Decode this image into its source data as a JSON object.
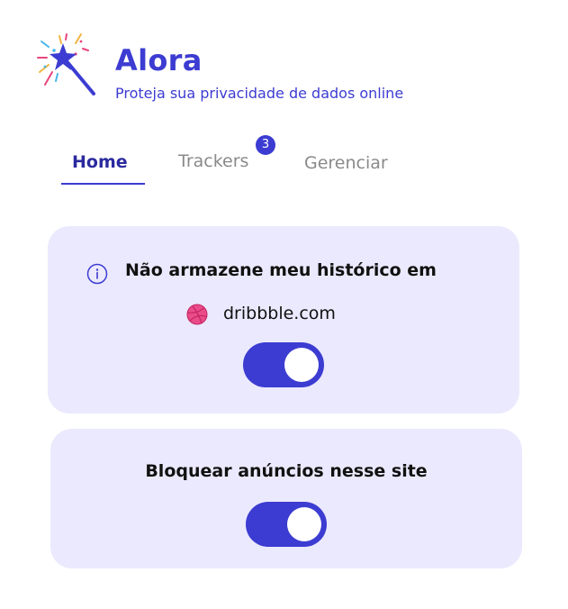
{
  "app": {
    "title": "Alora",
    "subtitle": "Proteja sua privacidade de dados online",
    "logo_icon": "magic-wand-icon",
    "accent_color": "#3c3cd2"
  },
  "tabs": [
    {
      "label": "Home",
      "active": true
    },
    {
      "label": "Trackers",
      "badge": "3"
    },
    {
      "label": "Gerenciar"
    }
  ],
  "history_card": {
    "info_icon": "info-icon",
    "title": "Não armazene meu histórico em",
    "site_icon": "dribbble-icon",
    "site": "dribbble.com",
    "toggle_on": true
  },
  "ads_card": {
    "title": "Bloquear anúncios nesse site",
    "toggle_on": true
  }
}
